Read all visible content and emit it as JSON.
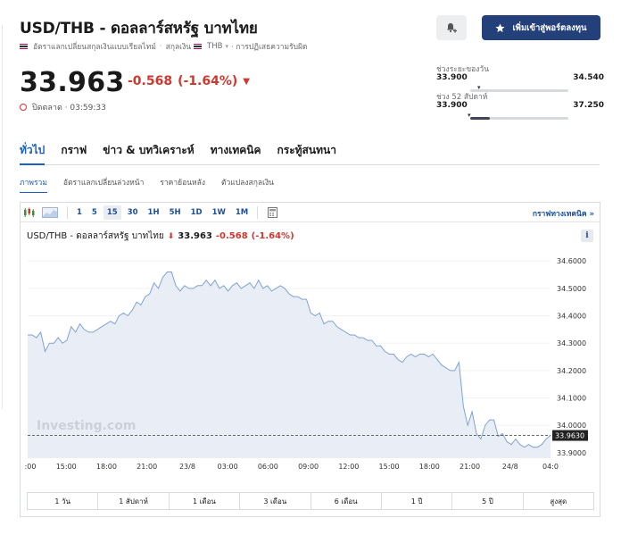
{
  "header": {
    "title": "USD/THB - ดอลลาร์สหรัฐ บาทไทย",
    "subtitle_realtime": "อัตราแลกเปลี่ยนสกุลเงินแบบเรียลไทม์",
    "subtitle_currency": "สกุลเงิน",
    "currency_code": "THB",
    "disclaimer": "· การปฏิเสธความรับผิด",
    "watchlist_label": "เพิ่มเข้าสู่พอร์ตลงทุน"
  },
  "quote": {
    "price": "33.963",
    "change": "-0.568",
    "change_pct": "(-1.64%)",
    "status": "ปิดตลาด · 03:59:33"
  },
  "ranges": {
    "day": {
      "label": "ช่วงระยะของวัน",
      "low": "33.900",
      "high": "34.540",
      "position": 0.1
    },
    "week52": {
      "label": "ช่วง 52 สัปดาห์",
      "low": "33.900",
      "high": "37.250",
      "position": 0.0,
      "fill": 0.2
    }
  },
  "tabs": [
    "ทั่วไป",
    "กราฟ",
    "ข่าว & บทวิเคราะห์",
    "ทางเทคนิค",
    "กระทู้สนทนา"
  ],
  "subtabs": [
    "ภาพรวม",
    "อัตราแลกเปลี่ยนล่วงหน้า",
    "ราคาย้อนหลัง",
    "ตัวแปลงสกุลเงิน"
  ],
  "toolbar": {
    "timeframes": [
      "1",
      "5",
      "15",
      "30",
      "1H",
      "5H",
      "1D",
      "1W",
      "1M"
    ],
    "selected": "15",
    "tech_chart": "กราฟทางเทคนิค"
  },
  "chart_head": {
    "name": "USD/THB - ดอลลาร์สหรัฐ บาทไทย",
    "price": "33.963",
    "change": "-0.568",
    "change_pct": "(-1.64%)"
  },
  "watermark": "Investing.com",
  "periods": [
    "1 วัน",
    "1 สัปดาห์",
    "1 เดือน",
    "3 เดือน",
    "6 เดือน",
    "1 ปี",
    "5 ปี",
    "สูงสุด"
  ],
  "colors": {
    "accent": "#1d5fb8",
    "negative": "#d0372d",
    "button": "#24407a",
    "line": "#7ea2d6",
    "area": "#e9eef6"
  },
  "chart_data": {
    "type": "area",
    "ylim": [
      33.88,
      34.63
    ],
    "yticks": [
      "34.6000",
      "34.5000",
      "34.4000",
      "34.3000",
      "34.2000",
      "34.1000",
      "34.0000",
      "33.9000"
    ],
    "ytick_values": [
      34.6,
      34.5,
      34.4,
      34.3,
      34.2,
      34.1,
      34.0,
      33.9
    ],
    "xticks": [
      ":00",
      "15:00",
      "18:00",
      "21:00",
      "23/8",
      "03:00",
      "06:00",
      "09:00",
      "12:00",
      "15:00",
      "18:00",
      "21:00",
      "24/8",
      "04:0"
    ],
    "last_value": "33.9630",
    "last": 33.963,
    "values": [
      34.33,
      34.33,
      34.32,
      34.34,
      34.27,
      34.3,
      34.3,
      34.32,
      34.3,
      34.31,
      34.36,
      34.34,
      34.37,
      34.35,
      34.34,
      34.34,
      34.35,
      34.36,
      34.37,
      34.38,
      34.37,
      34.4,
      34.41,
      34.4,
      34.42,
      34.45,
      34.44,
      34.47,
      34.48,
      34.52,
      34.5,
      34.54,
      34.56,
      34.56,
      34.51,
      34.49,
      34.51,
      34.5,
      34.5,
      34.51,
      34.51,
      34.53,
      34.51,
      34.53,
      34.5,
      34.51,
      34.49,
      34.51,
      34.52,
      34.5,
      34.51,
      34.52,
      34.5,
      34.53,
      34.5,
      34.51,
      34.49,
      34.5,
      34.51,
      34.5,
      34.48,
      34.47,
      34.47,
      34.46,
      34.46,
      34.41,
      34.4,
      34.41,
      34.37,
      34.38,
      34.38,
      34.36,
      34.35,
      34.34,
      34.33,
      34.33,
      34.32,
      34.32,
      34.31,
      34.31,
      34.29,
      34.29,
      34.27,
      34.26,
      34.26,
      34.24,
      34.23,
      34.25,
      34.26,
      34.25,
      34.26,
      34.26,
      34.25,
      34.26,
      34.24,
      34.22,
      34.21,
      34.2,
      34.2,
      34.23,
      34.07,
      34.0,
      34.05,
      33.97,
      33.95,
      34.0,
      34.02,
      34.02,
      33.96,
      33.97,
      33.94,
      33.93,
      33.95,
      33.93,
      33.92,
      33.93,
      33.92,
      33.92,
      33.93,
      33.95,
      33.963
    ]
  }
}
